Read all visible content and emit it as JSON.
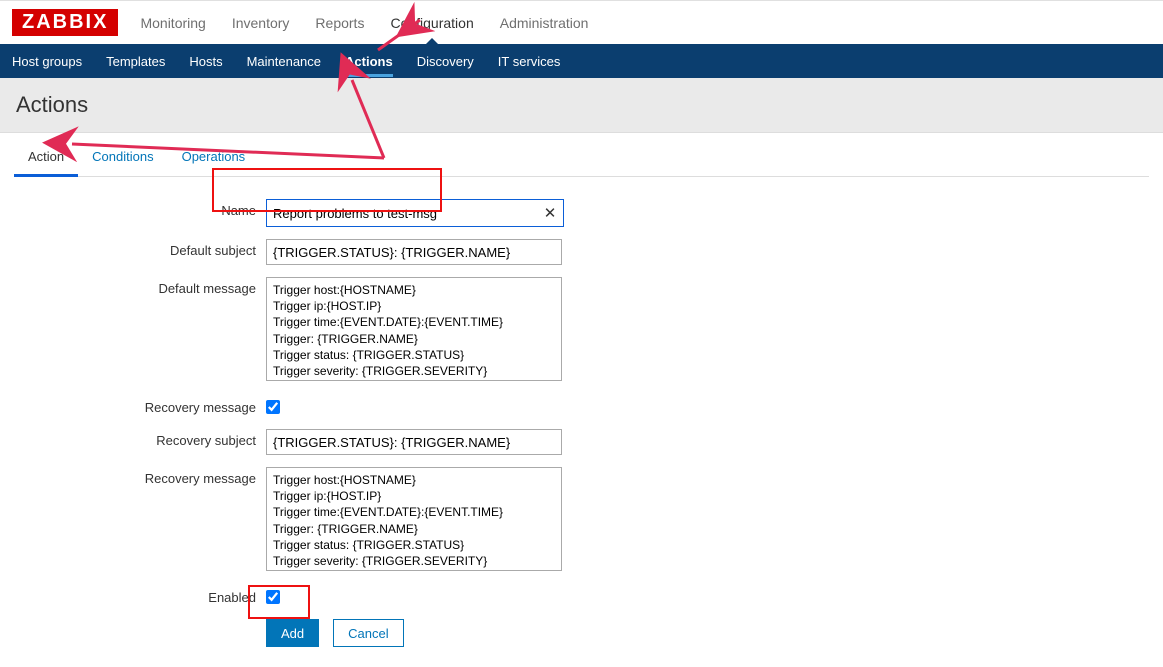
{
  "logo": "ZABBIX",
  "topnav": {
    "items": [
      "Monitoring",
      "Inventory",
      "Reports",
      "Configuration",
      "Administration"
    ],
    "active": "Configuration"
  },
  "subnav": {
    "items": [
      "Host groups",
      "Templates",
      "Hosts",
      "Maintenance",
      "Actions",
      "Discovery",
      "IT services"
    ],
    "active": "Actions"
  },
  "page_title": "Actions",
  "tabs": {
    "items": [
      "Action",
      "Conditions",
      "Operations"
    ],
    "active": "Action"
  },
  "form": {
    "name_label": "Name",
    "name_value": "Report problems to test-msg",
    "default_subject_label": "Default subject",
    "default_subject_value": "{TRIGGER.STATUS}: {TRIGGER.NAME}",
    "default_message_label": "Default message",
    "default_message_value": "Trigger host:{HOSTNAME}\nTrigger ip:{HOST.IP}\nTrigger time:{EVENT.DATE}:{EVENT.TIME}\nTrigger: {TRIGGER.NAME}\nTrigger status: {TRIGGER.STATUS}\nTrigger severity: {TRIGGER.SEVERITY}\nTrigger URL: {TRIGGER.URL}",
    "recovery_message_checkbox_label": "Recovery message",
    "recovery_message_checked": true,
    "recovery_subject_label": "Recovery subject",
    "recovery_subject_value": "{TRIGGER.STATUS}: {TRIGGER.NAME}",
    "recovery_message_label": "Recovery message",
    "recovery_message_value": "Trigger host:{HOSTNAME}\nTrigger ip:{HOST.IP}\nTrigger time:{EVENT.DATE}:{EVENT.TIME}\nTrigger: {TRIGGER.NAME}\nTrigger status: {TRIGGER.STATUS}\nTrigger severity: {TRIGGER.SEVERITY}\nTrigger URL: {TRIGGER.URL}",
    "enabled_label": "Enabled",
    "enabled_checked": true,
    "add_label": "Add",
    "cancel_label": "Cancel"
  }
}
